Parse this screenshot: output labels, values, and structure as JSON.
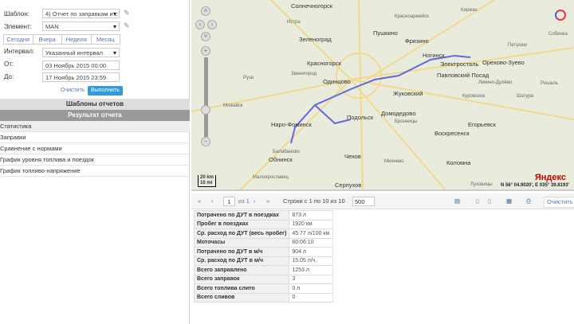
{
  "form": {
    "template_label": "Шаблон:",
    "template_value": "4) Отчет по заправкам и с",
    "element_label": "Элемент:",
    "element_value": "MAN",
    "periods": [
      "Сегодня",
      "Вчера",
      "Неделя",
      "Месяц"
    ],
    "interval_label": "Интервал:",
    "interval_value": "Указанный интервал",
    "from_label": "От:",
    "from_value": "03 Ноябрь 2015 00:00",
    "to_label": "До:",
    "to_value": "17 Ноябрь 2015 23:59",
    "clear": "Очистить",
    "run": "Выполнить"
  },
  "sections": {
    "templates": "Шаблоны отчетов",
    "result": "Результат отчета"
  },
  "result_items": [
    "Статистика",
    "Заправки",
    "Сравнение с нормами",
    "График уровня топлива и поездок",
    "График топливо-напряжение"
  ],
  "map": {
    "labels": [
      "Солнечногорск",
      "Зеленоград",
      "Пушкино",
      "Фрязино",
      "Красногорск",
      "Ногинск",
      "Электросталь",
      "Орехово-Зуево",
      "Павловский Посад",
      "Одинцово",
      "Жуковский",
      "Подольск",
      "Домодедово",
      "Наро-Фоминск",
      "Егорьевск",
      "Воскресенск",
      "Обнинск",
      "Чехов",
      "Коломна",
      "Серпухов",
      "Руза",
      "Можайск",
      "Киржач",
      "Петушки",
      "Шатура",
      "Рошаль",
      "Куровское",
      "Ликино-Дулёво",
      "Красноармейск",
      "Балабаново",
      "Малоярославец",
      "Истра",
      "Звенигород",
      "Бронницы",
      "Михнево",
      "Луховицы",
      "Собинка"
    ],
    "scale_km": "20 km",
    "scale_mi": "10 mi",
    "brand": "Яндекс",
    "coords": "N 56° 04.9020', E 035° 39.8193'"
  },
  "toolbar": {
    "first": "«",
    "prev": "‹",
    "page": "1",
    "of": "из 1",
    "next": "›",
    "last": "»",
    "rows": "Строки с 1 по 10 из 10",
    "per_page": "500",
    "clear": "Очистить"
  },
  "stats": [
    [
      "Потрачено по ДУТ в поездках",
      "873 л"
    ],
    [
      "Пробег в поездках",
      "1920 км"
    ],
    [
      "Ср. расход по ДУТ (весь пробег)",
      "45.77 л/100 км"
    ],
    [
      "Моточасы",
      "60:06:10"
    ],
    [
      "Потрачено по ДУТ в м/ч",
      "904 л"
    ],
    [
      "Ср. расход по ДУТ в м/ч",
      "15.05 л/ч."
    ],
    [
      "Всего заправлено",
      "1253 л"
    ],
    [
      "Всего заправок",
      "3"
    ],
    [
      "Всего топлива слито",
      "0 л"
    ],
    [
      "Всего сливов",
      "0"
    ]
  ],
  "colors": {
    "accent": "#3399dd",
    "header_gray": "#999999",
    "route": "#6666dd"
  }
}
